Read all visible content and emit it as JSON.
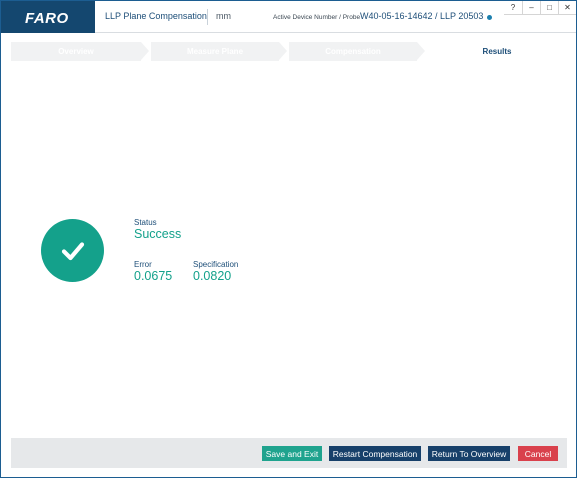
{
  "header": {
    "logo": "FARO",
    "app_title": "LLP Plane Compensation",
    "units": "mm",
    "device_label": "Active Device Number / Probe",
    "device_value": "W40-05-16-14642 / LLP 20503",
    "status_color": "#1b7fae"
  },
  "window_controls": {
    "help": "?",
    "minimize": "–",
    "maximize": "□",
    "close": "✕"
  },
  "steps": [
    {
      "label": "Overview",
      "state": "completed"
    },
    {
      "label": "Measure Plane",
      "state": "completed"
    },
    {
      "label": "Compensation",
      "state": "completed"
    },
    {
      "label": "Results",
      "state": "active"
    }
  ],
  "result": {
    "icon": "checkmark-icon",
    "status_label": "Status",
    "status_value": "Success",
    "error_label": "Error",
    "error_value": "0.0675",
    "spec_label": "Specification",
    "spec_value": "0.0820",
    "success_color": "#14a18b"
  },
  "footer": {
    "save_exit": "Save and Exit",
    "restart": "Restart Compensation",
    "return": "Return To Overview",
    "cancel": "Cancel"
  },
  "colors": {
    "brand": "#14476f",
    "primary_button": "#17406a",
    "success_button": "#1fa38e",
    "cancel_button": "#d9414c"
  }
}
